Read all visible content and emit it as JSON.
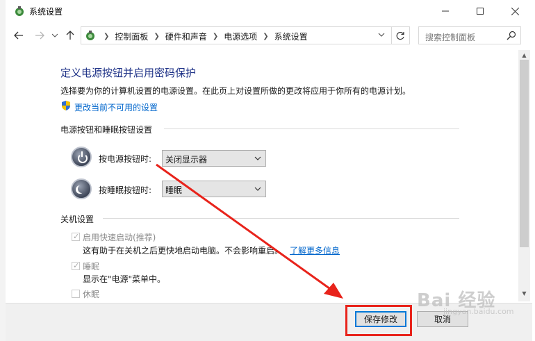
{
  "window": {
    "title": "系统设置"
  },
  "nav": {
    "breadcrumbs": [
      "控制面板",
      "硬件和声音",
      "电源选项",
      "系统设置"
    ],
    "search_placeholder": "搜索控制面板"
  },
  "main": {
    "title": "定义电源按钮并启用密码保护",
    "description": "选择要为你的计算机设置的电源设置。在此页上对设置所做的更改将应用于你所有的电源计划。",
    "change_link": "更改当前不可用的设置",
    "buttons_section": {
      "title": "电源按钮和睡眠按钮设置",
      "power_label": "按电源按钮时:",
      "power_value": "关闭显示器",
      "sleep_label": "按睡眠按钮时:",
      "sleep_value": "睡眠"
    },
    "shutdown_section": {
      "title": "关机设置",
      "items": [
        {
          "label": "启用快速启动(推荐)",
          "checked": true,
          "desc": "这有助于在关机之后更快地启动电脑。不会影响重启。",
          "link": "了解更多信息"
        },
        {
          "label": "睡眠",
          "checked": true,
          "desc": "显示在\"电源\"菜单中。"
        },
        {
          "label": "休眠",
          "checked": false
        }
      ]
    }
  },
  "footer": {
    "save_label": "保存修改",
    "cancel_label": "取消"
  },
  "annotation": {
    "color": "#e8231b"
  },
  "watermark": {
    "text": "Bai 经验",
    "sub": "jingyan.baidu.com"
  }
}
